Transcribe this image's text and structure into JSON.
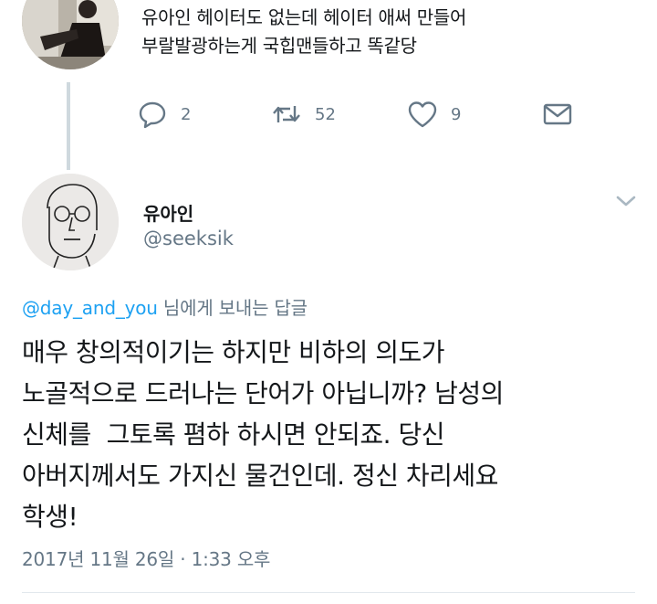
{
  "previous_tweet": {
    "text_line1": "유아인 헤이터도 없는데 헤이터 애써 만들어",
    "text_line2": "부랄발광하는게 국힙맨들하고 똑같당",
    "actions": {
      "reply_count": "2",
      "retweet_count": "52",
      "like_count": "9"
    }
  },
  "reply_tweet": {
    "display_name": "유아인",
    "handle": "@seeksik",
    "replying_to_handle": "@day_and_you",
    "replying_to_suffix": " 님에게 보내는 답글",
    "body": "매우 창의적이기는 하지만 비하의 의도가\n노골적으로 드러나는 단어가 아닙니까? 남성의\n신체를  그토록 폄하 하시면 안되죠. 당신\n아버지께서도 가지신 물건인데. 정신 차리세요\n학생!",
    "timestamp": "2017년 11월 26일 · 1:33 오후"
  },
  "colors": {
    "accent": "#1da1f2",
    "secondary_text": "#657786",
    "primary_text": "#14171a",
    "thread_line": "#cfd9de"
  },
  "icons": [
    "reply-icon",
    "retweet-icon",
    "like-icon",
    "direct-message-icon",
    "chevron-down-icon"
  ]
}
